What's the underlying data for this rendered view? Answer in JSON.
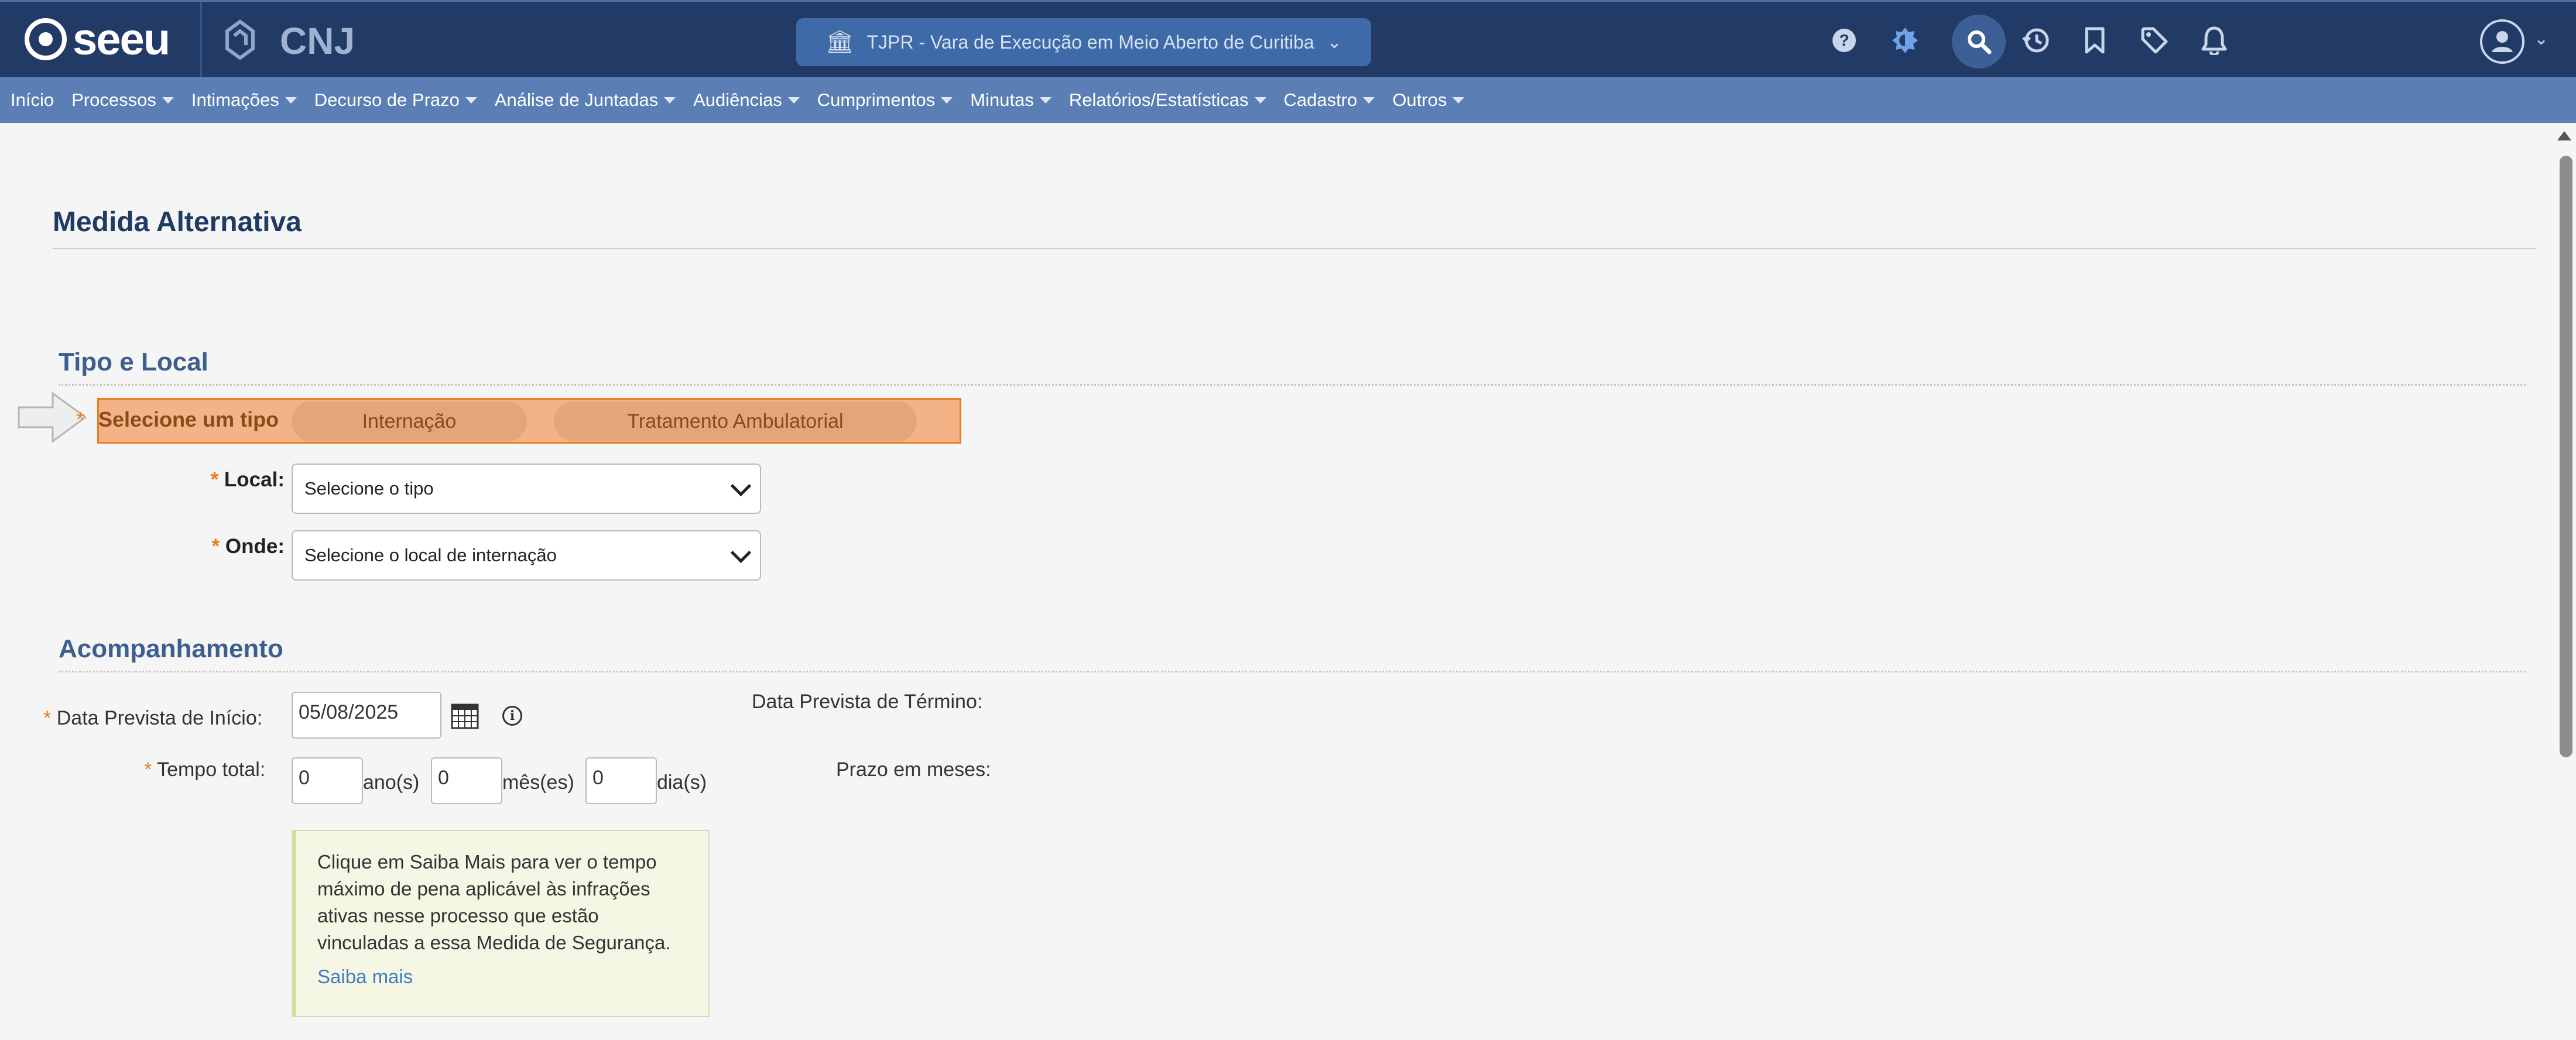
{
  "header": {
    "logo_text": "seeu",
    "alt_logo_1": "ᗝ",
    "alt_logo_2": "CNJ",
    "court_selector": "TJPR - Vara de Execução em Meio Aberto de Curitiba",
    "icons": [
      "help-icon",
      "theme-icon",
      "search-icon",
      "history-icon",
      "bookmark-icon",
      "tag-icon",
      "bell-icon",
      "user-avatar-icon"
    ]
  },
  "menu": {
    "items": [
      {
        "label": "Início",
        "dropdown": false
      },
      {
        "label": "Processos",
        "dropdown": true
      },
      {
        "label": "Intimações",
        "dropdown": true
      },
      {
        "label": "Decurso de Prazo",
        "dropdown": true
      },
      {
        "label": "Análise de Juntadas",
        "dropdown": true
      },
      {
        "label": "Audiências",
        "dropdown": true
      },
      {
        "label": "Cumprimentos",
        "dropdown": true
      },
      {
        "label": "Minutas",
        "dropdown": true
      },
      {
        "label": "Relatórios/Estatísticas",
        "dropdown": true
      },
      {
        "label": "Cadastro",
        "dropdown": true
      },
      {
        "label": "Outros",
        "dropdown": true
      }
    ]
  },
  "page": {
    "title": "Medida Alternativa"
  },
  "tipo_local": {
    "heading": "Tipo e Local",
    "tipo_label": "Selecione um tipo",
    "options": [
      "Internação",
      "Tratamento Ambulatorial"
    ],
    "local_label": "Local:",
    "local_value": "Selecione o tipo",
    "onde_label": "Onde:",
    "onde_value": "Selecione o local de internação",
    "required_mark": "*"
  },
  "acompanhamento": {
    "heading": "Acompanhamento",
    "data_inicio_label": "Data Prevista de Início:",
    "data_inicio_value": "05/08/2025",
    "data_termino_label": "Data Prevista de Término:",
    "tempo_total_label": "Tempo total:",
    "anos_value": "0",
    "anos_unit": "ano(s)",
    "meses_value": "0",
    "meses_unit": "mês(es)",
    "dias_value": "0",
    "dias_unit": "dia(s)",
    "prazo_meses_label": "Prazo em meses:",
    "note_text": "Clique em Saiba Mais para ver o tempo máximo de pena aplicável às infrações ativas nesse processo que estão vinculadas a essa Medida de Segurança.",
    "note_link": "Saiba mais"
  },
  "colors": {
    "topbar": "#213a66",
    "menubar": "#5b7fb5",
    "highlight": "#f4b386",
    "accent_orange": "#e67e22",
    "heading_blue": "#3d5f8e"
  }
}
